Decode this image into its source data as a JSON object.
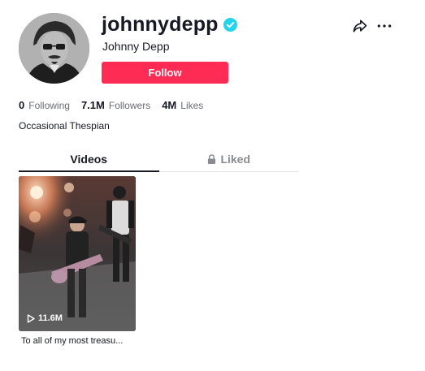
{
  "profile": {
    "username": "johnnydepp",
    "display_name": "Johnny Depp",
    "verified": true,
    "follow_label": "Follow",
    "bio": "Occasional Thespian"
  },
  "stats": {
    "following_count": "0",
    "following_label": "Following",
    "followers_count": "7.1M",
    "followers_label": "Followers",
    "likes_count": "4M",
    "likes_label": "Likes"
  },
  "tabs": {
    "videos_label": "Videos",
    "liked_label": "Liked"
  },
  "videos": [
    {
      "views": "11.6M",
      "caption": "To all of my most treasu..."
    }
  ],
  "icons": {
    "share": "share-arrow-icon",
    "more": "more-dots-icon",
    "verified": "verified-badge-icon",
    "lock": "lock-icon",
    "play": "play-icon"
  },
  "colors": {
    "accent": "#fe2c55",
    "verified": "#20d5ec",
    "text_primary": "#161823",
    "text_secondary": "#6b6c72"
  }
}
